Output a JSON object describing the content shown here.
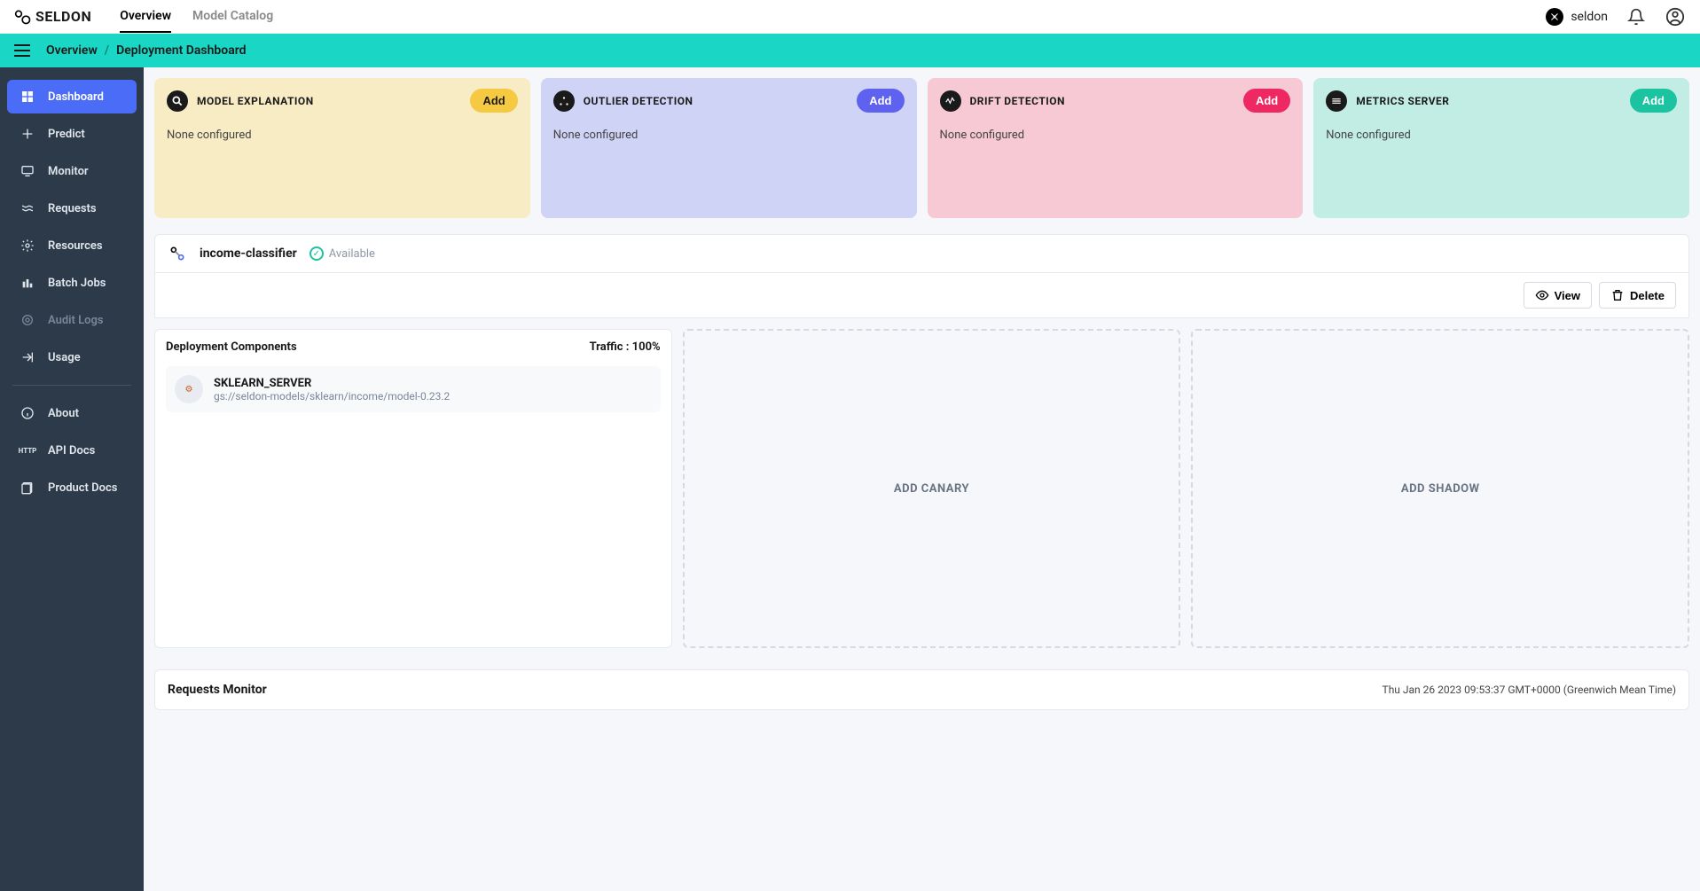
{
  "header": {
    "brand": "SELDON",
    "tabs": [
      {
        "label": "Overview",
        "active": true
      },
      {
        "label": "Model Catalog",
        "active": false
      }
    ],
    "user": "seldon"
  },
  "breadcrumb": {
    "root": "Overview",
    "current": "Deployment Dashboard"
  },
  "sidebar": {
    "primary": [
      {
        "label": "Dashboard",
        "icon": "dashboard",
        "active": true
      },
      {
        "label": "Predict",
        "icon": "plus"
      },
      {
        "label": "Monitor",
        "icon": "monitor"
      },
      {
        "label": "Requests",
        "icon": "waves"
      },
      {
        "label": "Resources",
        "icon": "gear"
      },
      {
        "label": "Batch Jobs",
        "icon": "bars"
      },
      {
        "label": "Audit Logs",
        "icon": "target",
        "disabled": true
      },
      {
        "label": "Usage",
        "icon": "arrow-out"
      }
    ],
    "secondary": [
      {
        "label": "About",
        "icon": "info"
      },
      {
        "label": "API Docs",
        "icon": "http"
      },
      {
        "label": "Product Docs",
        "icon": "docs"
      }
    ]
  },
  "cards": [
    {
      "title": "MODEL EXPLANATION",
      "status": "None configured",
      "add": "Add",
      "variant": "explain"
    },
    {
      "title": "OUTLIER DETECTION",
      "status": "None configured",
      "add": "Add",
      "variant": "outlier"
    },
    {
      "title": "DRIFT DETECTION",
      "status": "None configured",
      "add": "Add",
      "variant": "drift"
    },
    {
      "title": "METRICS SERVER",
      "status": "None configured",
      "add": "Add",
      "variant": "metrics"
    }
  ],
  "deployment": {
    "name": "income-classifier",
    "status": "Available",
    "actions": {
      "view": "View",
      "delete": "Delete"
    },
    "components_title": "Deployment Components",
    "traffic_label": "Traffic : 100%",
    "component": {
      "name": "SKLEARN_SERVER",
      "path": "gs://seldon-models/sklearn/income/model-0.23.2"
    },
    "add_canary": "ADD CANARY",
    "add_shadow": "ADD SHADOW"
  },
  "requests_monitor": {
    "title": "Requests Monitor",
    "timestamp": "Thu Jan 26 2023 09:53:37 GMT+0000 (Greenwich Mean Time)"
  }
}
